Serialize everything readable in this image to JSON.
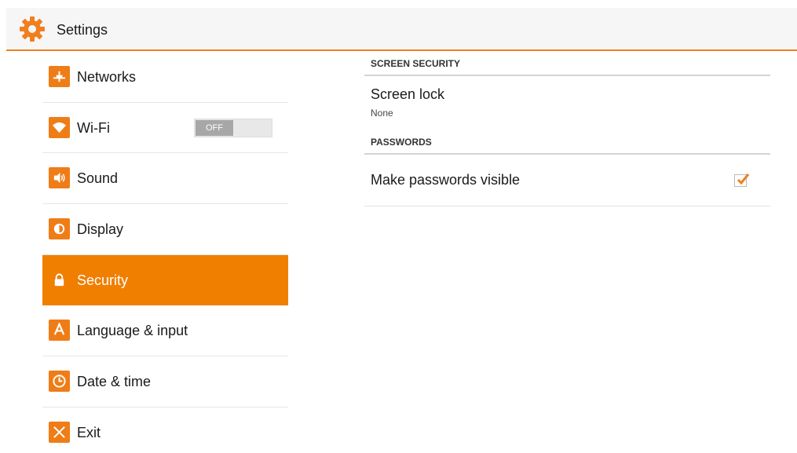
{
  "header": {
    "title": "Settings",
    "icon": "gear-icon",
    "accent": "#f07f1f"
  },
  "sidebar": {
    "items": [
      {
        "label": "Networks",
        "icon": "network-icon"
      },
      {
        "label": "Wi-Fi",
        "icon": "wifi-icon",
        "toggle": "OFF"
      },
      {
        "label": "Sound",
        "icon": "speaker-icon"
      },
      {
        "label": "Display",
        "icon": "brightness-icon"
      },
      {
        "label": "Security",
        "icon": "lock-icon",
        "active": true
      },
      {
        "label": "Language & input",
        "icon": "language-icon"
      },
      {
        "label": "Date & time",
        "icon": "clock-icon"
      },
      {
        "label": "Exit",
        "icon": "close-icon"
      }
    ]
  },
  "content": {
    "screen_security": {
      "header": "SCREEN SECURITY",
      "screen_lock": {
        "title": "Screen lock",
        "summary": "None"
      }
    },
    "passwords": {
      "header": "PASSWORDS",
      "make_visible": {
        "title": "Make passwords visible",
        "checked": true
      }
    }
  },
  "colors": {
    "active_bg": "#f07f00",
    "icon_bg": "#ef7d17",
    "toggle_off": "#a7a7a7"
  }
}
